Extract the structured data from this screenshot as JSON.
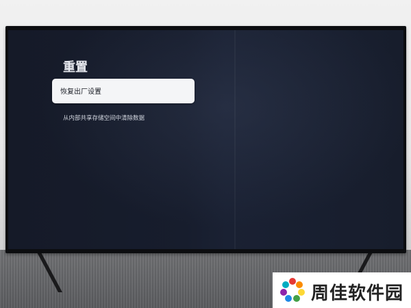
{
  "settings": {
    "title": "重置",
    "items": [
      {
        "label": "恢复出厂设置",
        "selected": true
      },
      {
        "label": "从内部共享存储空间中清除数据",
        "selected": false
      }
    ]
  },
  "watermark": {
    "text": "周佳软件园",
    "icon": "pinwheel-logo-icon"
  },
  "colors": {
    "screen_bg": "#171d2d",
    "selected_item_bg": "#f4f5f7",
    "text_light": "#e8eaf0"
  }
}
